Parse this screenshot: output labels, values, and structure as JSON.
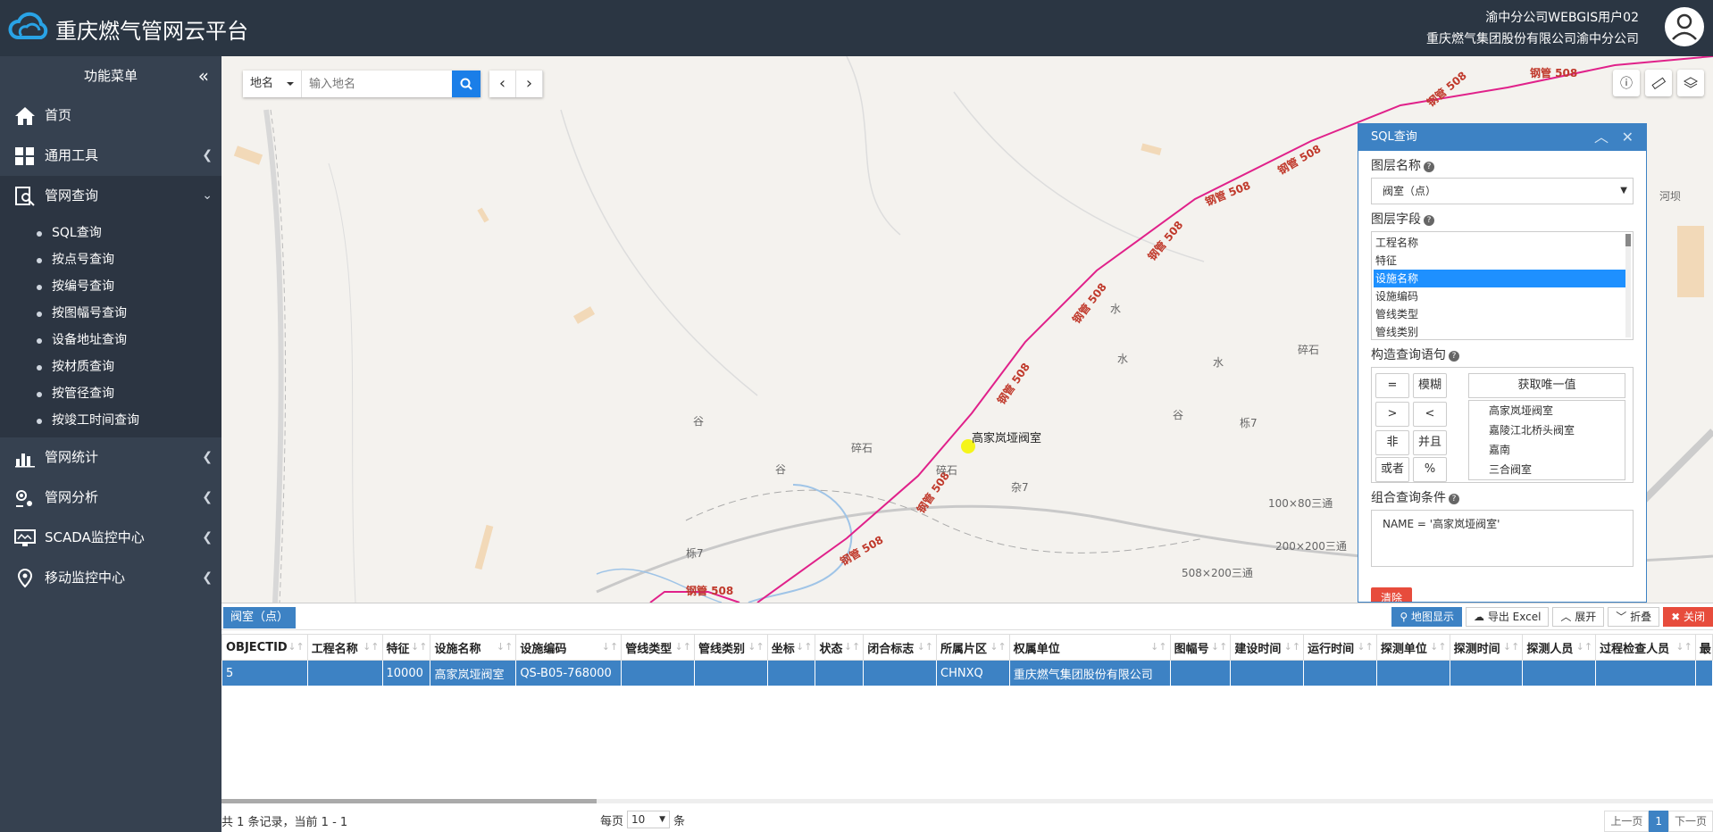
{
  "header": {
    "app_title": "重庆燃气管网云平台",
    "user_name": "渝中分公司WEBGIS用户02",
    "user_org": "重庆燃气集团股份有限公司渝中分公司"
  },
  "sidebar": {
    "title": "功能菜单",
    "items": [
      {
        "label": "首页",
        "icon": "home-icon"
      },
      {
        "label": "通用工具",
        "icon": "grid-icon"
      },
      {
        "label": "管网查询",
        "icon": "search-doc-icon"
      },
      {
        "label": "管网统计",
        "icon": "bar-chart-icon"
      },
      {
        "label": "管网分析",
        "icon": "analysis-icon"
      },
      {
        "label": "SCADA监控中心",
        "icon": "monitor-icon"
      },
      {
        "label": "移动监控中心",
        "icon": "location-icon"
      }
    ],
    "sub_items": [
      "SQL查询",
      "按点号查询",
      "按编号查询",
      "按图幅号查询",
      "设备地址查询",
      "按材质查询",
      "按管径查询",
      "按竣工时间查询"
    ]
  },
  "map": {
    "search_type": "地名",
    "search_placeholder": "输入地名",
    "labels": {
      "valve": "高家岚垭阀室",
      "pipe": "钢管 508",
      "water": "水",
      "gravel": "碎石",
      "valley": "谷",
      "misc1": "杂7",
      "misc2": "栎7",
      "tee1": "100×80三通",
      "tee2": "200×200三通",
      "tee3": "508×200三通",
      "dam": "河坝"
    }
  },
  "sql_panel": {
    "title": "SQL查询",
    "layer_name_label": "图层名称",
    "layer_selected": "阀室（点）",
    "layer_field_label": "图层字段",
    "fields": [
      "工程名称",
      "特征",
      "设施名称",
      "设施编码",
      "管线类型",
      "管线类别"
    ],
    "selected_field": "设施名称",
    "builder_label": "构造查询语句",
    "operators": [
      "=",
      "模糊",
      ">",
      "<",
      "非",
      "并且",
      "或者",
      "%"
    ],
    "unique_btn": "获取唯一值",
    "unique_values": [
      "高家岚垭阀室",
      "嘉陵江北桥头阀室",
      "嘉南",
      "三合阀室"
    ],
    "condition_label": "组合查询条件",
    "condition": "NAME = '高家岚垭阀室'",
    "clear_btn": "清除"
  },
  "grid": {
    "tab": "阀室（点）",
    "buttons": {
      "map_show": "地图显示",
      "export": "导出 Excel",
      "expand": "展开",
      "fold": "折叠",
      "close": "关闭"
    },
    "columns": [
      "OBJECTID",
      "工程名称",
      "特征",
      "设施名称",
      "设施编码",
      "管线类型",
      "管线类别",
      "坐标",
      "状态",
      "闭合标志",
      "所属片区",
      "权属单位",
      "图幅号",
      "建设时间",
      "运行时间",
      "探测单位",
      "探测时间",
      "探测人员",
      "过程检查人员",
      "最"
    ],
    "rows": [
      [
        "5",
        "",
        "10000",
        "高家岚垭阀室",
        "QS-B05-768000",
        "",
        "",
        "",
        "",
        "",
        "CHNXQ",
        "重庆燃气集团股份有限公司",
        "",
        "",
        "",
        "",
        "",
        "",
        "",
        ""
      ]
    ],
    "record_info": "共 1 条记录，当前 1 - 1",
    "page_size_label": "每页",
    "page_size": "10",
    "page_size_unit": "条",
    "prev": "上一页",
    "current_page": "1",
    "next": "下一页"
  }
}
